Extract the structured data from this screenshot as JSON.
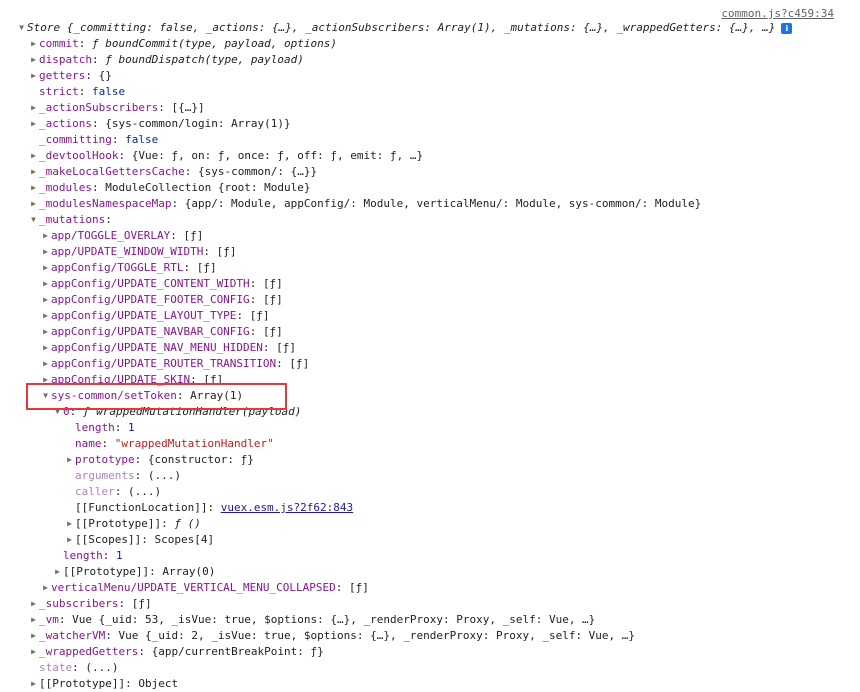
{
  "source_link": "common.js?c459:34",
  "info_badge": "i",
  "highlight_color": "#e53935",
  "colors": {
    "key": "#881391",
    "keyword": "#0d22aa",
    "number": "#1c00cf",
    "string": "#c41a16",
    "link": "#1a1aa6"
  },
  "rows": [
    {
      "indent": 16,
      "arrow": "open",
      "key": "",
      "val": "Store {_committing: false, _actions: {…}, _actionSubscribers: Array(1), _mutations: {…}, _wrappedGetters: {…}, …}",
      "valStyle": "italic",
      "info": true
    },
    {
      "indent": 28,
      "arrow": "closed",
      "key": "commit",
      "val": "ƒ boundCommit(type, payload, options)",
      "valStyle": "italic"
    },
    {
      "indent": 28,
      "arrow": "closed",
      "key": "dispatch",
      "val": "ƒ boundDispatch(type, payload)",
      "valStyle": "italic"
    },
    {
      "indent": 28,
      "arrow": "closed",
      "key": "getters",
      "val": "{}"
    },
    {
      "indent": 28,
      "arrow": "none",
      "key": "strict",
      "val": "false",
      "valStyle": "kw"
    },
    {
      "indent": 28,
      "arrow": "closed",
      "key": "_actionSubscribers",
      "val": "[{…}]"
    },
    {
      "indent": 28,
      "arrow": "closed",
      "key": "_actions",
      "val": "{sys-common/login: Array(1)}"
    },
    {
      "indent": 28,
      "arrow": "none",
      "key": "_committing",
      "val": "false",
      "valStyle": "kw"
    },
    {
      "indent": 28,
      "arrow": "closed",
      "key": "_devtoolHook",
      "val": "{Vue: ƒ, on: ƒ, once: ƒ, off: ƒ, emit: ƒ, …}"
    },
    {
      "indent": 28,
      "arrow": "closed",
      "key": "_makeLocalGettersCache",
      "val": "{sys-common/: {…}}"
    },
    {
      "indent": 28,
      "arrow": "closed",
      "key": "_modules",
      "val": "ModuleCollection {root: Module}"
    },
    {
      "indent": 28,
      "arrow": "closed",
      "key": "_modulesNamespaceMap",
      "val": "{app/: Module, appConfig/: Module, verticalMenu/: Module, sys-common/: Module}"
    },
    {
      "indent": 28,
      "arrow": "open",
      "key": "_mutations",
      "val": ""
    },
    {
      "indent": 40,
      "arrow": "closed",
      "key": "app/TOGGLE_OVERLAY",
      "val": "[ƒ]"
    },
    {
      "indent": 40,
      "arrow": "closed",
      "key": "app/UPDATE_WINDOW_WIDTH",
      "val": "[ƒ]"
    },
    {
      "indent": 40,
      "arrow": "closed",
      "key": "appConfig/TOGGLE_RTL",
      "val": "[ƒ]"
    },
    {
      "indent": 40,
      "arrow": "closed",
      "key": "appConfig/UPDATE_CONTENT_WIDTH",
      "val": "[ƒ]"
    },
    {
      "indent": 40,
      "arrow": "closed",
      "key": "appConfig/UPDATE_FOOTER_CONFIG",
      "val": "[ƒ]"
    },
    {
      "indent": 40,
      "arrow": "closed",
      "key": "appConfig/UPDATE_LAYOUT_TYPE",
      "val": "[ƒ]"
    },
    {
      "indent": 40,
      "arrow": "closed",
      "key": "appConfig/UPDATE_NAVBAR_CONFIG",
      "val": "[ƒ]"
    },
    {
      "indent": 40,
      "arrow": "closed",
      "key": "appConfig/UPDATE_NAV_MENU_HIDDEN",
      "val": "[ƒ]"
    },
    {
      "indent": 40,
      "arrow": "closed",
      "key": "appConfig/UPDATE_ROUTER_TRANSITION",
      "val": "[ƒ]"
    },
    {
      "indent": 40,
      "arrow": "closed",
      "key": "appConfig/UPDATE_SKIN",
      "val": "[ƒ]"
    },
    {
      "indent": 40,
      "arrow": "open",
      "key": "sys-common/setToken",
      "val": "Array(1)"
    },
    {
      "indent": 52,
      "arrow": "open",
      "key": "0",
      "val": "ƒ wrappedMutationHandler(payload)",
      "valStyle": "italic"
    },
    {
      "indent": 64,
      "arrow": "none",
      "key": "length",
      "val": "1",
      "valStyle": "num"
    },
    {
      "indent": 64,
      "arrow": "none",
      "key": "name",
      "val": "\"wrappedMutationHandler\"",
      "valStyle": "str"
    },
    {
      "indent": 64,
      "arrow": "closed",
      "key": "prototype",
      "val": "{constructor: ƒ}"
    },
    {
      "indent": 64,
      "arrow": "none",
      "key": "arguments",
      "val": "(...)",
      "keyStyle": "dim"
    },
    {
      "indent": 64,
      "arrow": "none",
      "key": "caller",
      "val": "(...)",
      "keyStyle": "dim"
    },
    {
      "indent": 64,
      "arrow": "none",
      "key": "[[FunctionLocation]]",
      "val": "vuex.esm.js?2f62:843",
      "keyStyle": "plain",
      "valStyle": "link"
    },
    {
      "indent": 64,
      "arrow": "closed",
      "key": "[[Prototype]]",
      "val": "ƒ ()",
      "keyStyle": "plain",
      "valStyle": "italic"
    },
    {
      "indent": 64,
      "arrow": "closed",
      "key": "[[Scopes]]",
      "val": "Scopes[4]",
      "keyStyle": "plain"
    },
    {
      "indent": 52,
      "arrow": "none",
      "key": "length",
      "val": "1",
      "valStyle": "num"
    },
    {
      "indent": 52,
      "arrow": "closed",
      "key": "[[Prototype]]",
      "val": "Array(0)",
      "keyStyle": "plain"
    },
    {
      "indent": 40,
      "arrow": "closed",
      "key": "verticalMenu/UPDATE_VERTICAL_MENU_COLLAPSED",
      "val": "[ƒ]"
    },
    {
      "indent": 28,
      "arrow": "closed",
      "key": "_subscribers",
      "val": "[ƒ]"
    },
    {
      "indent": 28,
      "arrow": "closed",
      "key": "_vm",
      "val": "Vue {_uid: 53, _isVue: true, $options: {…}, _renderProxy: Proxy, _self: Vue, …}"
    },
    {
      "indent": 28,
      "arrow": "closed",
      "key": "_watcherVM",
      "val": "Vue {_uid: 2, _isVue: true, $options: {…}, _renderProxy: Proxy, _self: Vue, …}"
    },
    {
      "indent": 28,
      "arrow": "closed",
      "key": "_wrappedGetters",
      "val": "{app/currentBreakPoint: ƒ}"
    },
    {
      "indent": 28,
      "arrow": "none",
      "key": "state",
      "val": "(...)",
      "keyStyle": "dim"
    },
    {
      "indent": 28,
      "arrow": "closed",
      "key": "[[Prototype]]",
      "val": "Object",
      "keyStyle": "plain"
    }
  ]
}
